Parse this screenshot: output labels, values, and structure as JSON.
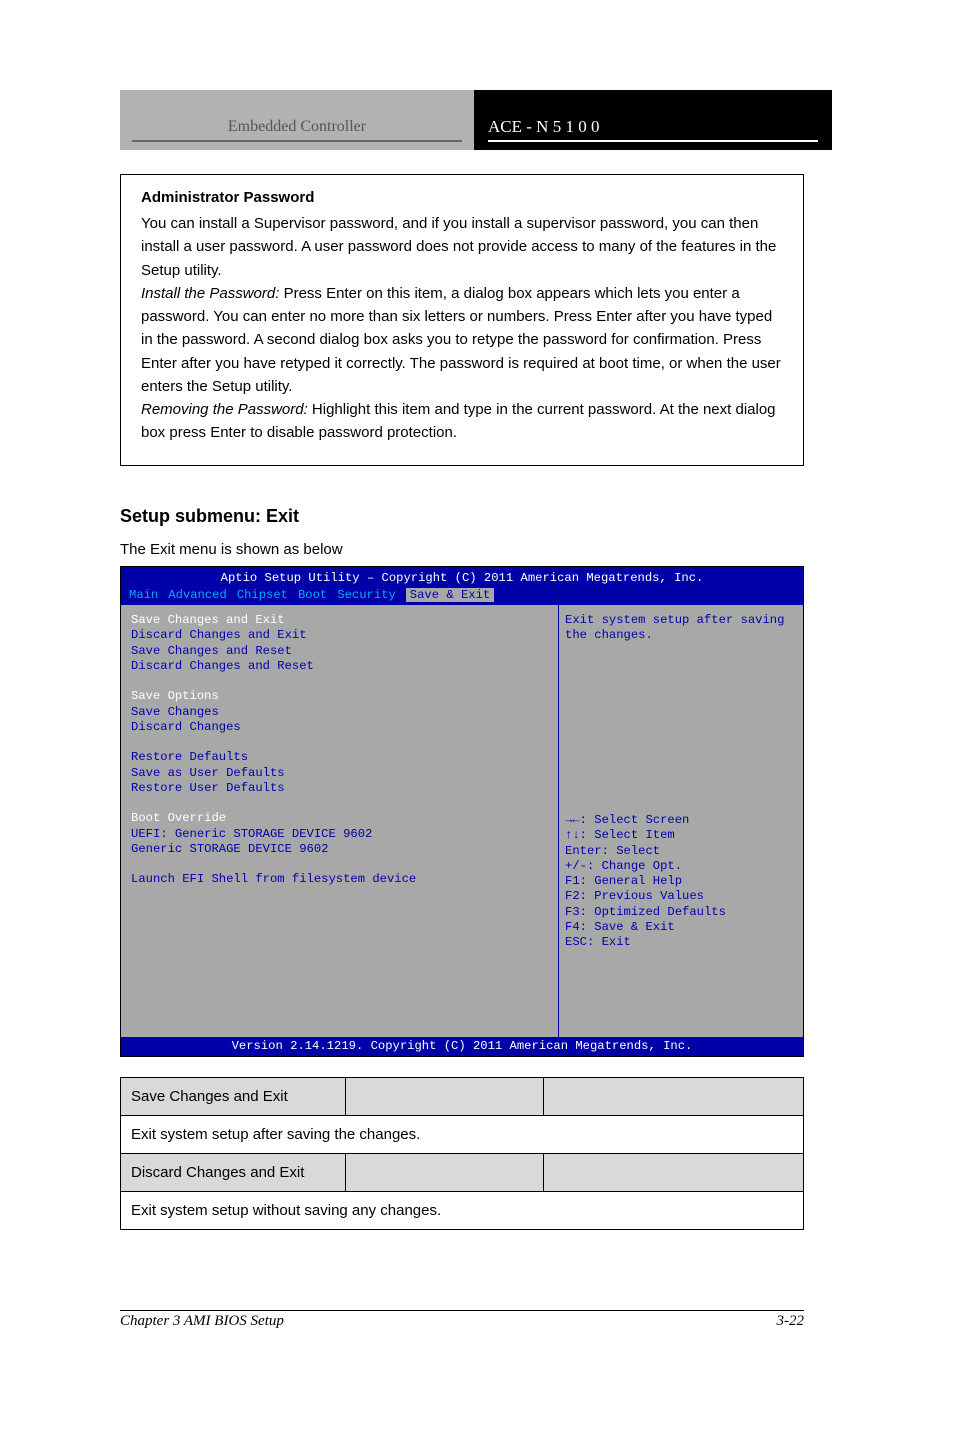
{
  "header": {
    "left_label": "Embedded Controller",
    "right_label": "ACE - N 5 1 0 0"
  },
  "info_box": {
    "title": "Administrator Password",
    "line1": "You can install a Supervisor password, and if you install a supervisor password, you can then install a user password. A user password does not provide access to many of the features in the Setup utility.",
    "line2_lead": "Install the Password:",
    "line2_body": "Press Enter on this item, a dialog box appears which lets you enter a password. You can enter no more than six letters or numbers. Press Enter after you have typed in the password. A second dialog box asks you to retype the password for confirmation. Press Enter after you have retyped it correctly. The password is required at boot time, or when the user enters the Setup utility.",
    "line3_lead": "Removing the Password:",
    "line3_body": "Highlight this item and type in the current password. At the next dialog box press Enter to disable password protection."
  },
  "exit": {
    "title": "Setup submenu: Exit",
    "subtitle": "The Exit menu is shown as below"
  },
  "bios": {
    "title": "Aptio Setup Utility – Copyright (C) 2011 American Megatrends, Inc.",
    "menu": [
      "Main",
      "Advanced",
      "Chipset",
      "Boot",
      "Security",
      "Save & Exit"
    ],
    "selected_menu": "Save & Exit",
    "left_items": [
      {
        "text": "Save Changes and Exit",
        "white": true
      },
      {
        "text": "Discard Changes and Exit"
      },
      {
        "text": "Save Changes and Reset"
      },
      {
        "text": "Discard Changes and Reset"
      },
      {
        "text": ""
      },
      {
        "text": "Save Options",
        "white": true
      },
      {
        "text": "Save Changes"
      },
      {
        "text": "Discard Changes"
      },
      {
        "text": ""
      },
      {
        "text": "Restore Defaults"
      },
      {
        "text": "Save as User Defaults"
      },
      {
        "text": "Restore User Defaults"
      },
      {
        "text": ""
      },
      {
        "text": "Boot Override",
        "white": true
      },
      {
        "text": "UEFI: Generic STORAGE DEVICE 9602"
      },
      {
        "text": "Generic STORAGE DEVICE 9602"
      },
      {
        "text": ""
      },
      {
        "text": "Launch EFI Shell from filesystem device"
      }
    ],
    "help_top": "Exit system setup after saving\nthe changes.",
    "help_keys": [
      "→←: Select Screen",
      "↑↓: Select Item",
      "Enter: Select",
      "+/-: Change Opt.",
      "F1: General Help",
      "F2: Previous Values",
      "F3: Optimized Defaults",
      "F4: Save & Exit",
      "ESC: Exit"
    ],
    "footer": "Version 2.14.1219. Copyright (C) 2011 American Megatrends, Inc."
  },
  "tables": [
    {
      "hdr": [
        "Save Changes and Exit",
        "",
        ""
      ],
      "desc": "Exit system setup after saving the changes."
    },
    {
      "hdr": [
        "Discard Changes and Exit",
        "",
        ""
      ],
      "desc": "Exit system setup without saving any changes."
    }
  ],
  "footer": {
    "left": "Chapter 3 AMI BIOS Setup",
    "right": "3-22"
  }
}
